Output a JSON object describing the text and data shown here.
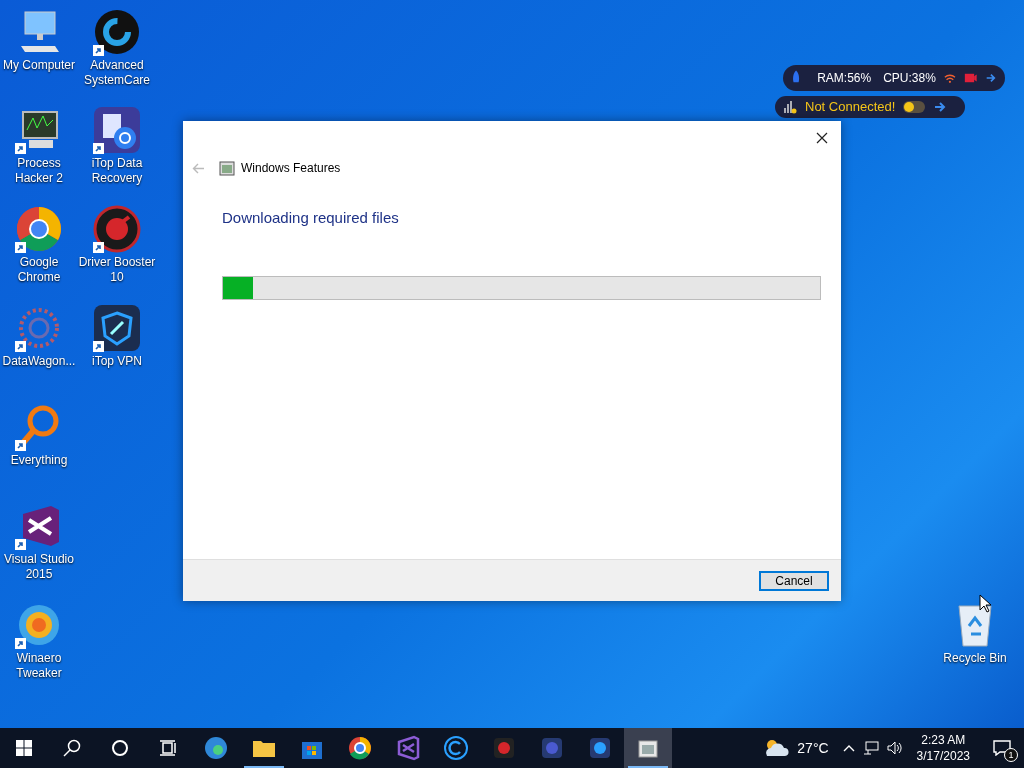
{
  "desktop_icons": [
    {
      "label": "My Computer"
    },
    {
      "label": "Advanced SystemCare"
    },
    {
      "label": "Process Hacker 2"
    },
    {
      "label": "iTop Data Recovery"
    },
    {
      "label": "Google Chrome"
    },
    {
      "label": "Driver Booster 10"
    },
    {
      "label": "DataWagon..."
    },
    {
      "label": "iTop VPN"
    },
    {
      "label": "Everything"
    },
    {
      "label": "Visual Studio 2015"
    },
    {
      "label": "Winaero Tweaker"
    },
    {
      "label": "Recycle Bin"
    }
  ],
  "monitor_widget": {
    "ram": "RAM:56%",
    "cpu": "CPU:38%"
  },
  "vpn_widget": {
    "status": "Not Connected!",
    "on": false
  },
  "dialog": {
    "title": "Windows Features",
    "heading": "Downloading required files",
    "progress": {
      "level": 0.05
    },
    "buttons": [
      "Cancel"
    ]
  },
  "taskbar": {
    "apps": [
      {
        "running": false,
        "selected": false
      },
      {
        "running": true,
        "selected": false
      },
      {
        "running": false,
        "selected": false
      },
      {
        "running": false,
        "selected": false
      },
      {
        "running": false,
        "selected": false
      },
      {
        "running": false,
        "selected": false
      },
      {
        "running": false,
        "selected": false
      },
      {
        "running": false,
        "selected": false
      },
      {
        "running": false,
        "selected": false
      },
      {
        "running": true,
        "selected": true
      }
    ],
    "temperature": "27°C",
    "time": "2:23 AM",
    "date": "3/17/2023",
    "notifications": "1"
  }
}
